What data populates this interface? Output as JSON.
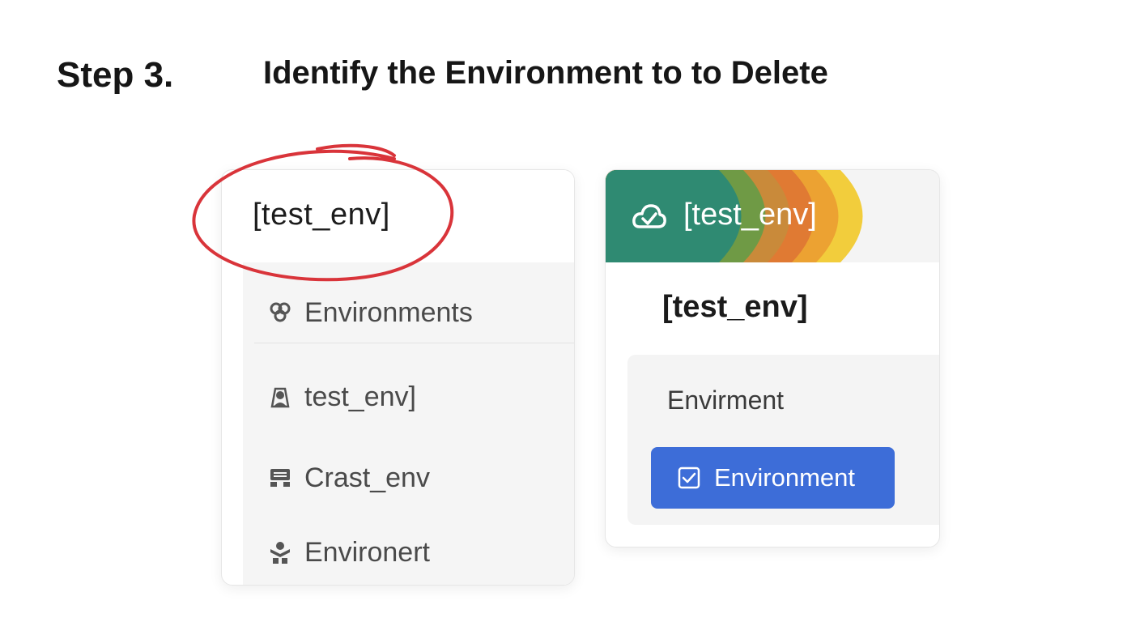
{
  "header": {
    "step_number": "Step 3.",
    "title": "Identify the Environment to to Delete"
  },
  "left_panel": {
    "header_label": "[test_env]",
    "items": [
      {
        "label": "Environments",
        "icon": "link-rings-icon"
      },
      {
        "label": "test_env]",
        "icon": "user-icon"
      },
      {
        "label": "Crast_env",
        "icon": "server-icon"
      },
      {
        "label": "Environert",
        "icon": "figure-icon"
      }
    ],
    "annotation_color": "#d9343a"
  },
  "right_panel": {
    "banner_label": "[test_env]",
    "banner_icon": "cloud-check-icon",
    "banner_colors": [
      "#2f8a72",
      "#6f9a45",
      "#c98a3a",
      "#e07a33",
      "#eca232",
      "#f2cd3c"
    ],
    "title": "[test_env]",
    "sub_label": "Envirment",
    "button_label": "Environment",
    "button_color": "#3d6dd8"
  }
}
